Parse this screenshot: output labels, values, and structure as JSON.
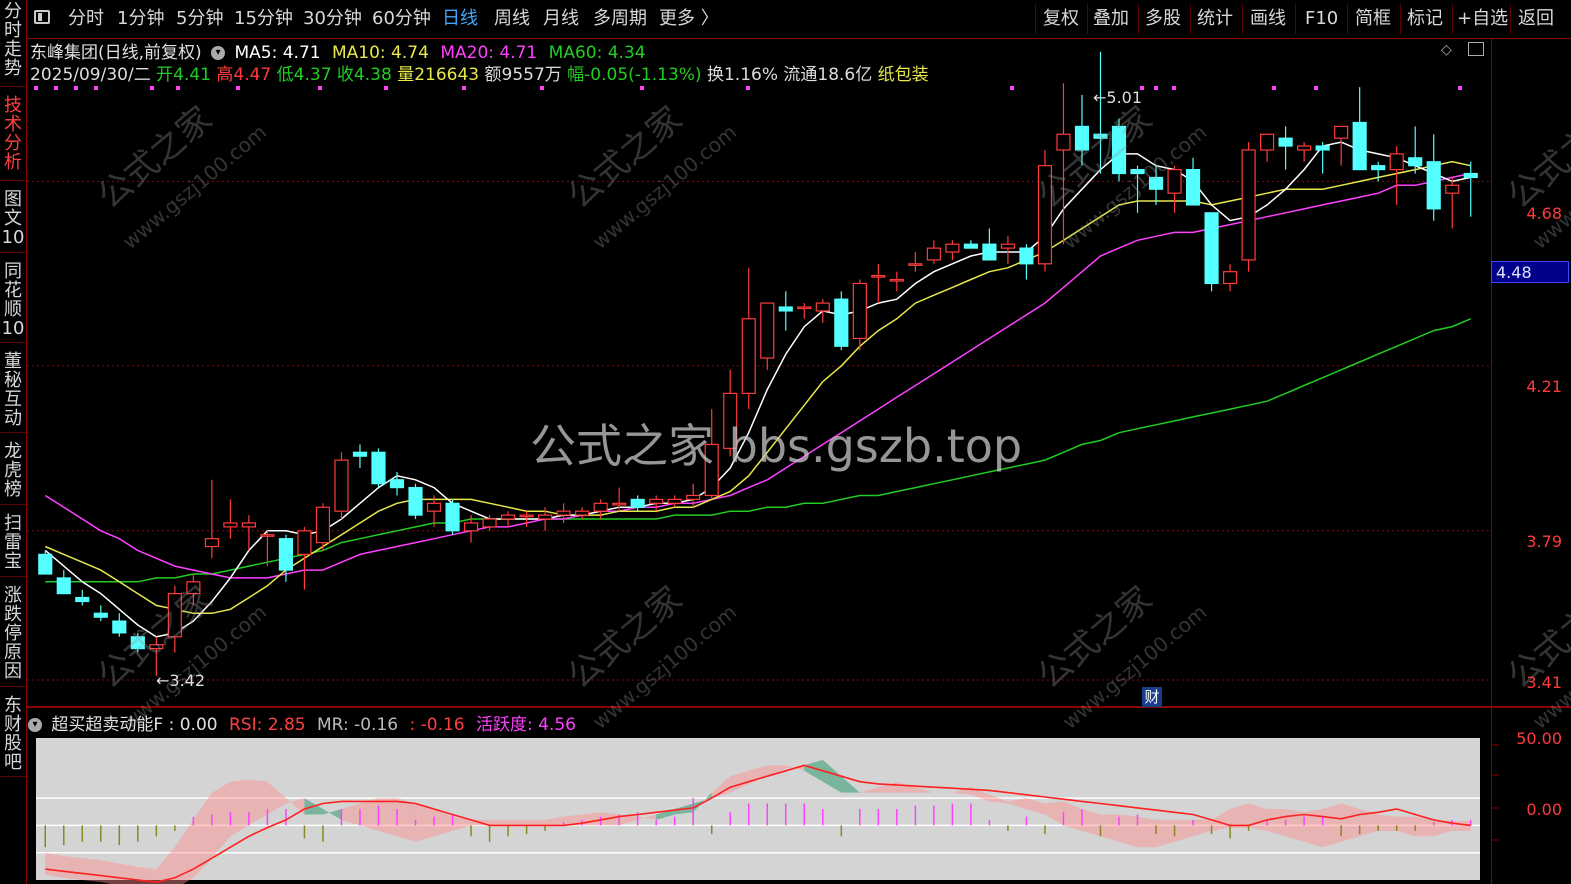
{
  "toolbar": {
    "items": [
      "分时",
      "1分钟",
      "5分钟",
      "15分钟",
      "30分钟",
      "60分钟",
      "日线",
      "周线",
      "月线",
      "多周期",
      "更多 〉"
    ],
    "active": "日线",
    "right_items": [
      "复权",
      "叠加",
      "多股",
      "统计",
      "画线",
      "F10",
      "简框",
      "标记",
      "+自选",
      "返回"
    ]
  },
  "sidebar": {
    "tabs": [
      "分时走势",
      "技术分析",
      "图文10",
      "同花顺10",
      "董秘互动",
      "龙虎榜",
      "扫雷宝",
      "涨跌停原因",
      "东财股吧"
    ],
    "active": "技术分析"
  },
  "header": {
    "stock_title": "东峰集团(日线,前复权)",
    "ma5": "MA5: 4.71",
    "ma10": "MA10: 4.74",
    "ma20": "MA20: 4.71",
    "ma60": "MA60: 4.34",
    "date": "2025/09/30/二",
    "open_label": "开",
    "open": "4.41",
    "high_label": "高",
    "high": "4.47",
    "low_label": "低",
    "low": "4.37",
    "close_label": "收",
    "close": "4.38",
    "volume_label": "量",
    "volume": "216643",
    "amount_label": "额",
    "amount": "9557万",
    "change_label": "幅",
    "change": "-0.05(-1.13%)",
    "turnover": "换1.16%",
    "float": "流通18.6亿",
    "industry": "纸包装"
  },
  "price_axis": [
    "4.68",
    "4.21",
    "3.79",
    "3.41"
  ],
  "current_price": "4.48",
  "annotations": {
    "high": "←5.01",
    "low": "←3.42",
    "cai_badge": "财"
  },
  "watermark": {
    "center": "公式之家 bbs.gszb.top",
    "tile": "公式之家",
    "tile_url": "www.gszj100.com"
  },
  "indicator": {
    "name": "超买超卖动能F",
    "value_f": ": 0.00",
    "rsi": "RSI: 2.85",
    "mr": "MR: -0.16",
    "extra": ": -0.16",
    "activity": "活跃度: 4.56",
    "axis": [
      "50.00",
      "0.00"
    ]
  },
  "colors": {
    "up": "#ff3b3b",
    "down": "#54ffff",
    "ma5": "#ffffff",
    "ma10": "#e8e84a",
    "ma20": "#ff40ff",
    "ma60": "#22cc22",
    "bg": "#000000",
    "border": "#8b0000"
  },
  "chart_data": {
    "type": "candlestick",
    "candles": [
      {
        "o": 3.73,
        "h": 3.74,
        "l": 3.68,
        "c": 3.68
      },
      {
        "o": 3.67,
        "h": 3.69,
        "l": 3.63,
        "c": 3.63
      },
      {
        "o": 3.62,
        "h": 3.64,
        "l": 3.6,
        "c": 3.61
      },
      {
        "o": 3.58,
        "h": 3.6,
        "l": 3.56,
        "c": 3.57
      },
      {
        "o": 3.56,
        "h": 3.58,
        "l": 3.52,
        "c": 3.53
      },
      {
        "o": 3.52,
        "h": 3.53,
        "l": 3.48,
        "c": 3.49
      },
      {
        "o": 3.49,
        "h": 3.52,
        "l": 3.42,
        "c": 3.5
      },
      {
        "o": 3.52,
        "h": 3.65,
        "l": 3.48,
        "c": 3.63
      },
      {
        "o": 3.63,
        "h": 3.68,
        "l": 3.6,
        "c": 3.66
      },
      {
        "o": 3.75,
        "h": 3.92,
        "l": 3.72,
        "c": 3.77
      },
      {
        "o": 3.8,
        "h": 3.87,
        "l": 3.77,
        "c": 3.81
      },
      {
        "o": 3.8,
        "h": 3.83,
        "l": 3.74,
        "c": 3.81
      },
      {
        "o": 3.78,
        "h": 3.79,
        "l": 3.7,
        "c": 3.78
      },
      {
        "o": 3.77,
        "h": 3.78,
        "l": 3.66,
        "c": 3.69
      },
      {
        "o": 3.73,
        "h": 3.8,
        "l": 3.64,
        "c": 3.79
      },
      {
        "o": 3.76,
        "h": 3.86,
        "l": 3.74,
        "c": 3.85
      },
      {
        "o": 3.84,
        "h": 3.99,
        "l": 3.82,
        "c": 3.97
      },
      {
        "o": 3.99,
        "h": 4.01,
        "l": 3.95,
        "c": 3.98
      },
      {
        "o": 3.99,
        "h": 4.0,
        "l": 3.9,
        "c": 3.91
      },
      {
        "o": 3.92,
        "h": 3.94,
        "l": 3.88,
        "c": 3.9
      },
      {
        "o": 3.9,
        "h": 3.91,
        "l": 3.82,
        "c": 3.83
      },
      {
        "o": 3.84,
        "h": 3.88,
        "l": 3.8,
        "c": 3.86
      },
      {
        "o": 3.86,
        "h": 3.87,
        "l": 3.78,
        "c": 3.79
      },
      {
        "o": 3.79,
        "h": 3.83,
        "l": 3.76,
        "c": 3.81
      },
      {
        "o": 3.8,
        "h": 3.83,
        "l": 3.79,
        "c": 3.82
      },
      {
        "o": 3.82,
        "h": 3.84,
        "l": 3.8,
        "c": 3.83
      },
      {
        "o": 3.83,
        "h": 3.84,
        "l": 3.8,
        "c": 3.83
      },
      {
        "o": 3.82,
        "h": 3.85,
        "l": 3.79,
        "c": 3.83
      },
      {
        "o": 3.83,
        "h": 3.86,
        "l": 3.81,
        "c": 3.84
      },
      {
        "o": 3.83,
        "h": 3.85,
        "l": 3.82,
        "c": 3.84
      },
      {
        "o": 3.84,
        "h": 3.87,
        "l": 3.82,
        "c": 3.86
      },
      {
        "o": 3.86,
        "h": 3.9,
        "l": 3.84,
        "c": 3.86
      },
      {
        "o": 3.87,
        "h": 3.88,
        "l": 3.84,
        "c": 3.85
      },
      {
        "o": 3.86,
        "h": 3.88,
        "l": 3.84,
        "c": 3.87
      },
      {
        "o": 3.86,
        "h": 3.88,
        "l": 3.85,
        "c": 3.87
      },
      {
        "o": 3.87,
        "h": 3.91,
        "l": 3.85,
        "c": 3.88
      },
      {
        "o": 3.88,
        "h": 4.1,
        "l": 3.87,
        "c": 4.01
      },
      {
        "o": 4.0,
        "h": 4.2,
        "l": 3.98,
        "c": 4.14
      },
      {
        "o": 4.14,
        "h": 4.46,
        "l": 4.1,
        "c": 4.33
      },
      {
        "o": 4.23,
        "h": 4.36,
        "l": 4.2,
        "c": 4.37
      },
      {
        "o": 4.36,
        "h": 4.4,
        "l": 4.3,
        "c": 4.35
      },
      {
        "o": 4.36,
        "h": 4.37,
        "l": 4.33,
        "c": 4.36
      },
      {
        "o": 4.35,
        "h": 4.38,
        "l": 4.32,
        "c": 4.37
      },
      {
        "o": 4.38,
        "h": 4.4,
        "l": 4.25,
        "c": 4.26
      },
      {
        "o": 4.28,
        "h": 4.43,
        "l": 4.25,
        "c": 4.42
      },
      {
        "o": 4.44,
        "h": 4.47,
        "l": 4.37,
        "c": 4.44
      },
      {
        "o": 4.43,
        "h": 4.45,
        "l": 4.4,
        "c": 4.43
      },
      {
        "o": 4.47,
        "h": 4.5,
        "l": 4.45,
        "c": 4.47
      },
      {
        "o": 4.48,
        "h": 4.53,
        "l": 4.47,
        "c": 4.51
      },
      {
        "o": 4.5,
        "h": 4.53,
        "l": 4.48,
        "c": 4.52
      },
      {
        "o": 4.52,
        "h": 4.53,
        "l": 4.51,
        "c": 4.51
      },
      {
        "o": 4.52,
        "h": 4.56,
        "l": 4.48,
        "c": 4.48
      },
      {
        "o": 4.51,
        "h": 4.54,
        "l": 4.47,
        "c": 4.52
      },
      {
        "o": 4.51,
        "h": 4.52,
        "l": 4.43,
        "c": 4.47
      },
      {
        "o": 4.47,
        "h": 4.76,
        "l": 4.45,
        "c": 4.72
      },
      {
        "o": 4.76,
        "h": 4.93,
        "l": 4.52,
        "c": 4.8
      },
      {
        "o": 4.82,
        "h": 4.9,
        "l": 4.72,
        "c": 4.76
      },
      {
        "o": 4.8,
        "h": 5.01,
        "l": 4.7,
        "c": 4.79
      },
      {
        "o": 4.82,
        "h": 4.84,
        "l": 4.68,
        "c": 4.7
      },
      {
        "o": 4.71,
        "h": 4.72,
        "l": 4.6,
        "c": 4.7
      },
      {
        "o": 4.69,
        "h": 4.72,
        "l": 4.62,
        "c": 4.66
      },
      {
        "o": 4.65,
        "h": 4.72,
        "l": 4.6,
        "c": 4.71
      },
      {
        "o": 4.71,
        "h": 4.74,
        "l": 4.62,
        "c": 4.62
      },
      {
        "o": 4.6,
        "h": 4.6,
        "l": 4.4,
        "c": 4.42
      },
      {
        "o": 4.42,
        "h": 4.47,
        "l": 4.4,
        "c": 4.45
      },
      {
        "o": 4.48,
        "h": 4.78,
        "l": 4.45,
        "c": 4.76
      },
      {
        "o": 4.76,
        "h": 4.8,
        "l": 4.73,
        "c": 4.8
      },
      {
        "o": 4.79,
        "h": 4.82,
        "l": 4.71,
        "c": 4.77
      },
      {
        "o": 4.76,
        "h": 4.78,
        "l": 4.73,
        "c": 4.77
      },
      {
        "o": 4.77,
        "h": 4.78,
        "l": 4.7,
        "c": 4.76
      },
      {
        "o": 4.79,
        "h": 4.82,
        "l": 4.72,
        "c": 4.82
      },
      {
        "o": 4.83,
        "h": 4.92,
        "l": 4.72,
        "c": 4.71
      },
      {
        "o": 4.72,
        "h": 4.73,
        "l": 4.68,
        "c": 4.71
      },
      {
        "o": 4.71,
        "h": 4.77,
        "l": 4.62,
        "c": 4.75
      },
      {
        "o": 4.74,
        "h": 4.82,
        "l": 4.7,
        "c": 4.72
      },
      {
        "o": 4.73,
        "h": 4.8,
        "l": 4.58,
        "c": 4.61
      },
      {
        "o": 4.65,
        "h": 4.69,
        "l": 4.56,
        "c": 4.67
      },
      {
        "o": 4.7,
        "h": 4.73,
        "l": 4.59,
        "c": 4.69
      }
    ],
    "ma5": [
      3.74,
      3.7,
      3.66,
      3.63,
      3.59,
      3.55,
      3.52,
      3.53,
      3.56,
      3.61,
      3.67,
      3.74,
      3.79,
      3.79,
      3.78,
      3.79,
      3.82,
      3.86,
      3.9,
      3.93,
      3.92,
      3.9,
      3.86,
      3.84,
      3.82,
      3.82,
      3.82,
      3.82,
      3.83,
      3.83,
      3.84,
      3.85,
      3.85,
      3.86,
      3.86,
      3.87,
      3.9,
      3.95,
      4.04,
      4.15,
      4.24,
      4.31,
      4.35,
      4.34,
      4.35,
      4.37,
      4.38,
      4.42,
      4.45,
      4.47,
      4.49,
      4.5,
      4.5,
      4.5,
      4.54,
      4.61,
      4.66,
      4.71,
      4.75,
      4.75,
      4.72,
      4.71,
      4.68,
      4.62,
      4.58,
      4.59,
      4.62,
      4.66,
      4.71,
      4.77,
      4.78,
      4.76,
      4.75,
      4.74,
      4.72,
      4.7,
      4.68,
      4.69
    ],
    "ma10": [
      3.75,
      3.73,
      3.71,
      3.69,
      3.66,
      3.63,
      3.6,
      3.59,
      3.58,
      3.58,
      3.59,
      3.62,
      3.65,
      3.69,
      3.72,
      3.75,
      3.78,
      3.81,
      3.84,
      3.86,
      3.87,
      3.87,
      3.87,
      3.87,
      3.86,
      3.85,
      3.84,
      3.84,
      3.83,
      3.83,
      3.83,
      3.84,
      3.84,
      3.84,
      3.85,
      3.85,
      3.87,
      3.89,
      3.93,
      3.99,
      4.05,
      4.11,
      4.17,
      4.21,
      4.26,
      4.3,
      4.33,
      4.37,
      4.39,
      4.41,
      4.43,
      4.45,
      4.46,
      4.48,
      4.5,
      4.53,
      4.56,
      4.59,
      4.62,
      4.63,
      4.63,
      4.63,
      4.63,
      4.62,
      4.63,
      4.64,
      4.65,
      4.66,
      4.66,
      4.66,
      4.67,
      4.68,
      4.69,
      4.7,
      4.71,
      4.72,
      4.73,
      4.72
    ],
    "ma20": [
      3.88,
      3.85,
      3.82,
      3.79,
      3.77,
      3.74,
      3.72,
      3.7,
      3.69,
      3.68,
      3.67,
      3.67,
      3.67,
      3.68,
      3.69,
      3.69,
      3.71,
      3.73,
      3.74,
      3.75,
      3.76,
      3.77,
      3.78,
      3.79,
      3.8,
      3.8,
      3.81,
      3.82,
      3.82,
      3.83,
      3.84,
      3.84,
      3.85,
      3.85,
      3.86,
      3.86,
      3.87,
      3.88,
      3.9,
      3.92,
      3.95,
      3.98,
      4.01,
      4.04,
      4.07,
      4.1,
      4.13,
      4.16,
      4.19,
      4.22,
      4.25,
      4.28,
      4.31,
      4.34,
      4.37,
      4.41,
      4.45,
      4.49,
      4.51,
      4.53,
      4.54,
      4.55,
      4.55,
      4.56,
      4.57,
      4.58,
      4.59,
      4.6,
      4.61,
      4.62,
      4.63,
      4.64,
      4.65,
      4.67,
      4.67,
      4.68,
      4.69,
      4.7
    ],
    "ma60": [
      3.66,
      3.66,
      3.66,
      3.66,
      3.66,
      3.66,
      3.67,
      3.67,
      3.68,
      3.68,
      3.69,
      3.7,
      3.71,
      3.72,
      3.73,
      3.74,
      3.76,
      3.77,
      3.78,
      3.79,
      3.8,
      3.81,
      3.81,
      3.82,
      3.82,
      3.82,
      3.82,
      3.82,
      3.82,
      3.82,
      3.82,
      3.82,
      3.82,
      3.82,
      3.83,
      3.83,
      3.83,
      3.84,
      3.84,
      3.85,
      3.85,
      3.86,
      3.86,
      3.87,
      3.88,
      3.88,
      3.89,
      3.9,
      3.91,
      3.92,
      3.93,
      3.94,
      3.95,
      3.96,
      3.97,
      3.99,
      4.01,
      4.02,
      4.04,
      4.05,
      4.06,
      4.07,
      4.08,
      4.09,
      4.1,
      4.11,
      4.12,
      4.14,
      4.16,
      4.18,
      4.2,
      4.22,
      4.24,
      4.26,
      4.28,
      4.3,
      4.31,
      4.33
    ],
    "ylim": [
      3.41,
      4.9
    ],
    "indicator_ylim": [
      -50,
      80
    ],
    "indicator_line": [
      -40,
      -42,
      -44,
      -46,
      -48,
      -50,
      -52,
      -48,
      -40,
      -30,
      -20,
      -10,
      -2,
      5,
      15,
      20,
      22,
      22,
      22,
      22,
      20,
      15,
      10,
      5,
      0,
      0,
      0,
      0,
      0,
      2,
      5,
      8,
      10,
      12,
      14,
      16,
      25,
      35,
      40,
      45,
      50,
      55,
      50,
      45,
      40,
      38,
      37,
      36,
      35,
      34,
      33,
      32,
      30,
      28,
      26,
      24,
      22,
      20,
      18,
      16,
      14,
      12,
      10,
      5,
      0,
      0,
      5,
      8,
      10,
      8,
      6,
      10,
      12,
      15,
      10,
      5,
      2,
      0
    ],
    "indicator_upper": [
      -25,
      -28,
      -30,
      -32,
      -35,
      -38,
      -40,
      -20,
      5,
      30,
      40,
      42,
      40,
      25,
      10,
      10,
      15,
      20,
      25,
      25,
      20,
      15,
      8,
      5,
      5,
      5,
      5,
      5,
      8,
      10,
      12,
      10,
      8,
      5,
      10,
      12,
      30,
      45,
      50,
      55,
      55,
      50,
      40,
      30,
      30,
      35,
      40,
      35,
      30,
      30,
      35,
      28,
      22,
      25,
      20,
      22,
      15,
      10,
      10,
      8,
      5,
      5,
      5,
      5,
      15,
      20,
      15,
      15,
      12,
      15,
      20,
      15,
      10,
      8,
      8,
      5,
      4,
      4
    ],
    "indicator_lower": [
      -45,
      -48,
      -50,
      -52,
      -55,
      -58,
      -60,
      -58,
      -48,
      -30,
      -10,
      0,
      10,
      20,
      25,
      15,
      5,
      0,
      -5,
      -10,
      -15,
      -10,
      -5,
      0,
      0,
      0,
      0,
      0,
      0,
      0,
      0,
      0,
      5,
      10,
      15,
      20,
      25,
      30,
      38,
      45,
      52,
      55,
      60,
      45,
      30,
      30,
      30,
      30,
      30,
      30,
      28,
      22,
      20,
      15,
      10,
      0,
      -5,
      -10,
      -15,
      -20,
      -20,
      -15,
      -10,
      -5,
      -2,
      -2,
      -5,
      -10,
      -15,
      -20,
      -15,
      -10,
      -5,
      -5,
      -10,
      -10,
      -5,
      -5
    ],
    "indicator_bars": [
      -20,
      -18,
      -15,
      -15,
      -18,
      -15,
      -10,
      -5,
      8,
      10,
      12,
      12,
      15,
      15,
      -12,
      -15,
      15,
      15,
      18,
      15,
      5,
      8,
      10,
      -10,
      -15,
      -10,
      -8,
      -5,
      3,
      5,
      8,
      10,
      12,
      5,
      8,
      25,
      -8,
      12,
      20,
      20,
      20,
      20,
      15,
      -10,
      15,
      15,
      15,
      18,
      18,
      20,
      20,
      5,
      -5,
      8,
      -8,
      12,
      15,
      -10,
      8,
      10,
      -8,
      -10,
      5,
      -8,
      -12,
      -5,
      5,
      5,
      8,
      8,
      -10,
      -8,
      -5,
      -5,
      -5,
      3,
      5,
      5
    ]
  }
}
